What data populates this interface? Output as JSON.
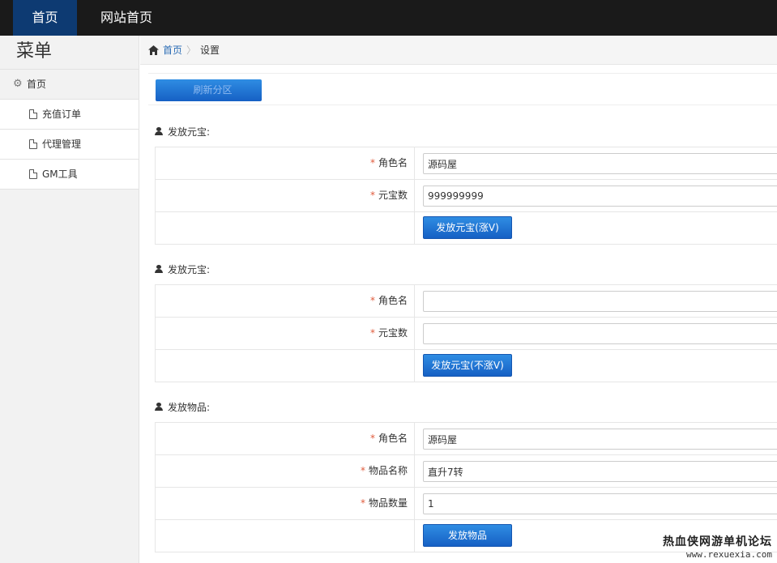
{
  "topbar": {
    "home": "首页",
    "site_home": "网站首页"
  },
  "sidebar": {
    "title": "菜单",
    "group": "首页",
    "items": [
      {
        "label": "充值订单"
      },
      {
        "label": "代理管理"
      },
      {
        "label": "GM工具"
      }
    ]
  },
  "breadcrumb": {
    "home": "首页",
    "current": "设置"
  },
  "top_button": {
    "label": "刷新分区"
  },
  "section1": {
    "title": "发放元宝:",
    "role_label": "角色名",
    "role_value": "源码屋",
    "amount_label": "元宝数",
    "amount_value": "999999999",
    "button": "发放元宝(涨V)"
  },
  "section2": {
    "title": "发放元宝:",
    "role_label": "角色名",
    "role_value": "",
    "amount_label": "元宝数",
    "amount_value": "",
    "button": "发放元宝(不涨V)"
  },
  "section3": {
    "title": "发放物品:",
    "role_label": "角色名",
    "role_value": "源码屋",
    "item_name_label": "物品名称",
    "item_name_value": "直升7转",
    "item_qty_label": "物品数量",
    "item_qty_value": "1",
    "button": "发放物品"
  },
  "watermark": {
    "line1": "热血侠网游单机论坛",
    "line2": "www.rexuexia.com"
  },
  "colors": {
    "topbar": "#1a1a1a",
    "active_nav": "#0d3a72",
    "primary_button": "#1f74d4",
    "required": "#e05b3c",
    "link": "#2a6cb5"
  }
}
